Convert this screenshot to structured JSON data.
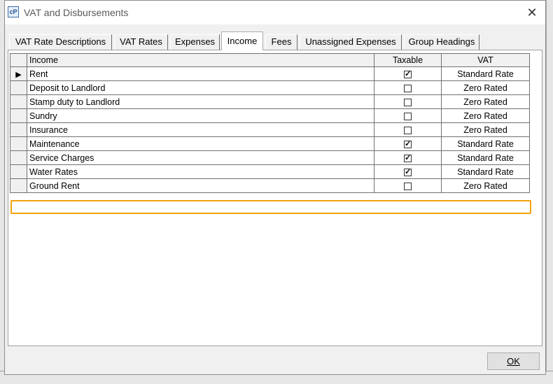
{
  "window": {
    "title": "VAT and Disbursements",
    "close_glyph": "✕"
  },
  "tabs": [
    {
      "label": "VAT Rate Descriptions",
      "active": false
    },
    {
      "label": "VAT Rates",
      "active": false
    },
    {
      "label": "Expenses",
      "active": false
    },
    {
      "label": "Income",
      "active": true
    },
    {
      "label": "Fees",
      "active": false
    },
    {
      "label": "Unassigned Expenses",
      "active": false
    },
    {
      "label": "Group Headings",
      "active": false
    }
  ],
  "grid": {
    "columns": [
      "Income",
      "Taxable",
      "VAT"
    ],
    "rows": [
      {
        "income": "Rent",
        "taxable": true,
        "vat": "Standard Rate",
        "current": true
      },
      {
        "income": "Deposit to Landlord",
        "taxable": false,
        "vat": "Zero Rated"
      },
      {
        "income": "Stamp duty to Landlord",
        "taxable": false,
        "vat": "Zero Rated"
      },
      {
        "income": "Sundry",
        "taxable": false,
        "vat": "Zero Rated"
      },
      {
        "income": "Insurance",
        "taxable": false,
        "vat": "Zero Rated"
      },
      {
        "income": "Maintenance",
        "taxable": true,
        "vat": "Standard Rate"
      },
      {
        "income": "Service Charges",
        "taxable": true,
        "vat": "Standard Rate",
        "highlighted": true
      },
      {
        "income": "Water Rates",
        "taxable": true,
        "vat": "Standard Rate"
      },
      {
        "income": "Ground Rent",
        "taxable": false,
        "vat": "Zero Rated"
      }
    ]
  },
  "buttons": {
    "ok_label": "OK"
  },
  "colors": {
    "highlight": "#f0a30a",
    "dialog_bg": "#f0f0f0"
  }
}
